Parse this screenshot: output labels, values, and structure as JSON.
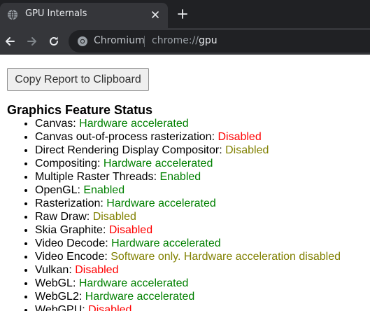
{
  "tab": {
    "title": "GPU Internals",
    "favicon": "globe-icon",
    "close_icon": "close-icon",
    "new_tab_icon": "plus-icon"
  },
  "toolbar": {
    "back_icon": "arrow-left-icon",
    "forward_icon": "arrow-right-icon",
    "reload_icon": "reload-icon",
    "site_label": "Chromium",
    "url_scheme": "chrome://",
    "url_host": "gpu"
  },
  "page": {
    "copy_button_label": "Copy Report to Clipboard",
    "section_title": "Graphics Feature Status",
    "features": [
      {
        "name": "Canvas",
        "status": "Hardware accelerated",
        "level": "green"
      },
      {
        "name": "Canvas out-of-process rasterization",
        "status": "Disabled",
        "level": "red"
      },
      {
        "name": "Direct Rendering Display Compositor",
        "status": "Disabled",
        "level": "olive"
      },
      {
        "name": "Compositing",
        "status": "Hardware accelerated",
        "level": "green"
      },
      {
        "name": "Multiple Raster Threads",
        "status": "Enabled",
        "level": "green"
      },
      {
        "name": "OpenGL",
        "status": "Enabled",
        "level": "green"
      },
      {
        "name": "Rasterization",
        "status": "Hardware accelerated",
        "level": "green"
      },
      {
        "name": "Raw Draw",
        "status": "Disabled",
        "level": "olive"
      },
      {
        "name": "Skia Graphite",
        "status": "Disabled",
        "level": "red"
      },
      {
        "name": "Video Decode",
        "status": "Hardware accelerated",
        "level": "green"
      },
      {
        "name": "Video Encode",
        "status": "Software only. Hardware acceleration disabled",
        "level": "olive"
      },
      {
        "name": "Vulkan",
        "status": "Disabled",
        "level": "red"
      },
      {
        "name": "WebGL",
        "status": "Hardware accelerated",
        "level": "green"
      },
      {
        "name": "WebGL2",
        "status": "Hardware accelerated",
        "level": "green"
      },
      {
        "name": "WebGPU",
        "status": "Disabled",
        "level": "red"
      }
    ]
  },
  "colors": {
    "status_green": "#008000",
    "status_olive": "#808000",
    "status_red": "#ff0000",
    "chrome_dark": "#202124",
    "chrome_tab": "#35363a"
  }
}
